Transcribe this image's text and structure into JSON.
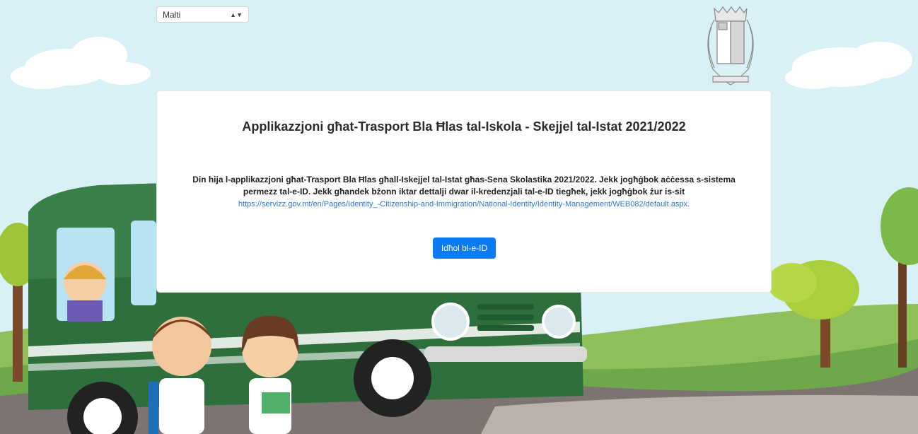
{
  "language_select": {
    "value": "Malti"
  },
  "crest": {
    "icon": "malta-coat-of-arms-icon"
  },
  "card": {
    "title": "Applikazzjoni għat-Trasport Bla Ħlas tal-Iskola - Skejjel tal-Istat 2021/2022",
    "body_line1": "Din hija l-applikazzjoni għat-Trasport Bla Ħlas għall-Iskejjel tal-Istat għas-Sena Skolastika 2021/2022. Jekk jogħġbok aċċessa s-sistema",
    "body_line2": "permezz tal-e-ID. Jekk għandek bżonn iktar dettalji dwar il-kredenzjali tal-e-ID tiegħek, jekk jogħġbok żur is-sit",
    "link": "https://servizz.gov.mt/en/Pages/Identity_-Citizenship-and-Immigration/National-Identity/Identity-Management/WEB082/default.aspx.",
    "login_button": "Idħol bl-e-ID"
  },
  "colors": {
    "primary": "#0a7bf2",
    "link": "#2a79d4",
    "bus_green": "#2f6f3e",
    "sky": "#d7eef5"
  }
}
